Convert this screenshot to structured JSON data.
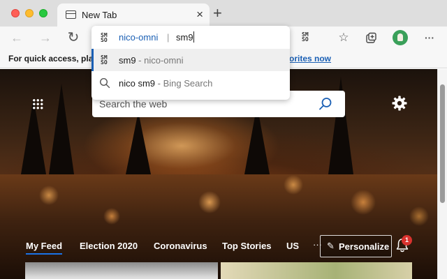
{
  "tab": {
    "title": "New Tab",
    "close_glyph": "×",
    "favicon": "newtab-icon"
  },
  "new_tab_glyph": "+",
  "toolbar": {
    "back_glyph": "←",
    "forward_glyph": "→",
    "refresh_glyph": "↻",
    "favorite_glyph": "☆",
    "menu_glyph": "···",
    "extension_label_top": "SM",
    "extension_label_bottom": "SO"
  },
  "omnibox": {
    "keyword": "nico-omni",
    "separator": "|",
    "query": "sm9",
    "suggestions": [
      {
        "main": "sm9",
        "sub": " - nico-omni",
        "icon": "smso-icon"
      },
      {
        "main": "nico sm9",
        "sub": " - Bing Search",
        "icon": "search-icon"
      }
    ]
  },
  "favorites_bar": {
    "text": "For quick access, plac",
    "link": "orites now"
  },
  "page": {
    "search_placeholder": "Search the web",
    "feed_tabs": [
      "My Feed",
      "Election 2020",
      "Coronavirus",
      "Top Stories",
      "US"
    ],
    "more_glyph": "···",
    "personalize_label": "Personalize",
    "personalize_glyph": "✎",
    "notifications_count": "1"
  },
  "colors": {
    "accent": "#1a5fb4",
    "badge": "#d9322e",
    "avatar": "#3aa05a"
  }
}
